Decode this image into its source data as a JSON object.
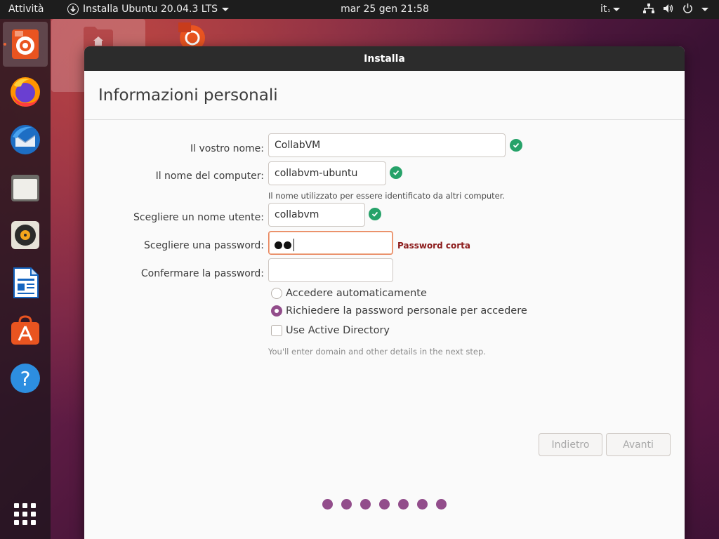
{
  "topbar": {
    "activities": "Attività",
    "app_menu_label": "Installa Ubuntu 20.04.3 LTS",
    "clock": "mar 25 gen  21:58",
    "keyboard_layout": "it"
  },
  "window": {
    "title": "Installa",
    "page_title": "Informazioni personali"
  },
  "form": {
    "name_label": "Il vostro nome:",
    "name_value": "CollabVM",
    "computer_label": "Il nome del computer:",
    "computer_value": "collabvm-ubuntu",
    "computer_hint": "Il nome utilizzato per essere identificato da altri computer.",
    "username_label": "Scegliere un nome utente:",
    "username_value": "collabvm",
    "password_label": "Scegliere una password:",
    "password_error": "Password corta",
    "confirm_label": "Confermare la password:",
    "confirm_value": "",
    "option_auto_login": "Accedere automaticamente",
    "option_require_password": "Richiedere la password personale per accedere",
    "option_active_directory": "Use Active Directory",
    "ad_note": "You'll enter domain and other details in the next step."
  },
  "buttons": {
    "back": "Indietro",
    "next": "Avanti"
  },
  "colors": {
    "accent": "#924d8b",
    "valid": "#26a269",
    "error": "#8b1a1a",
    "ubuntu_orange": "#e95420"
  },
  "dock": {
    "icons": [
      "ubuntu-installer-icon",
      "firefox-icon",
      "thunderbird-icon",
      "files-icon",
      "rhythmbox-icon",
      "libreoffice-writer-icon",
      "software-center-icon",
      "help-icon",
      "show-apps-icon"
    ]
  }
}
